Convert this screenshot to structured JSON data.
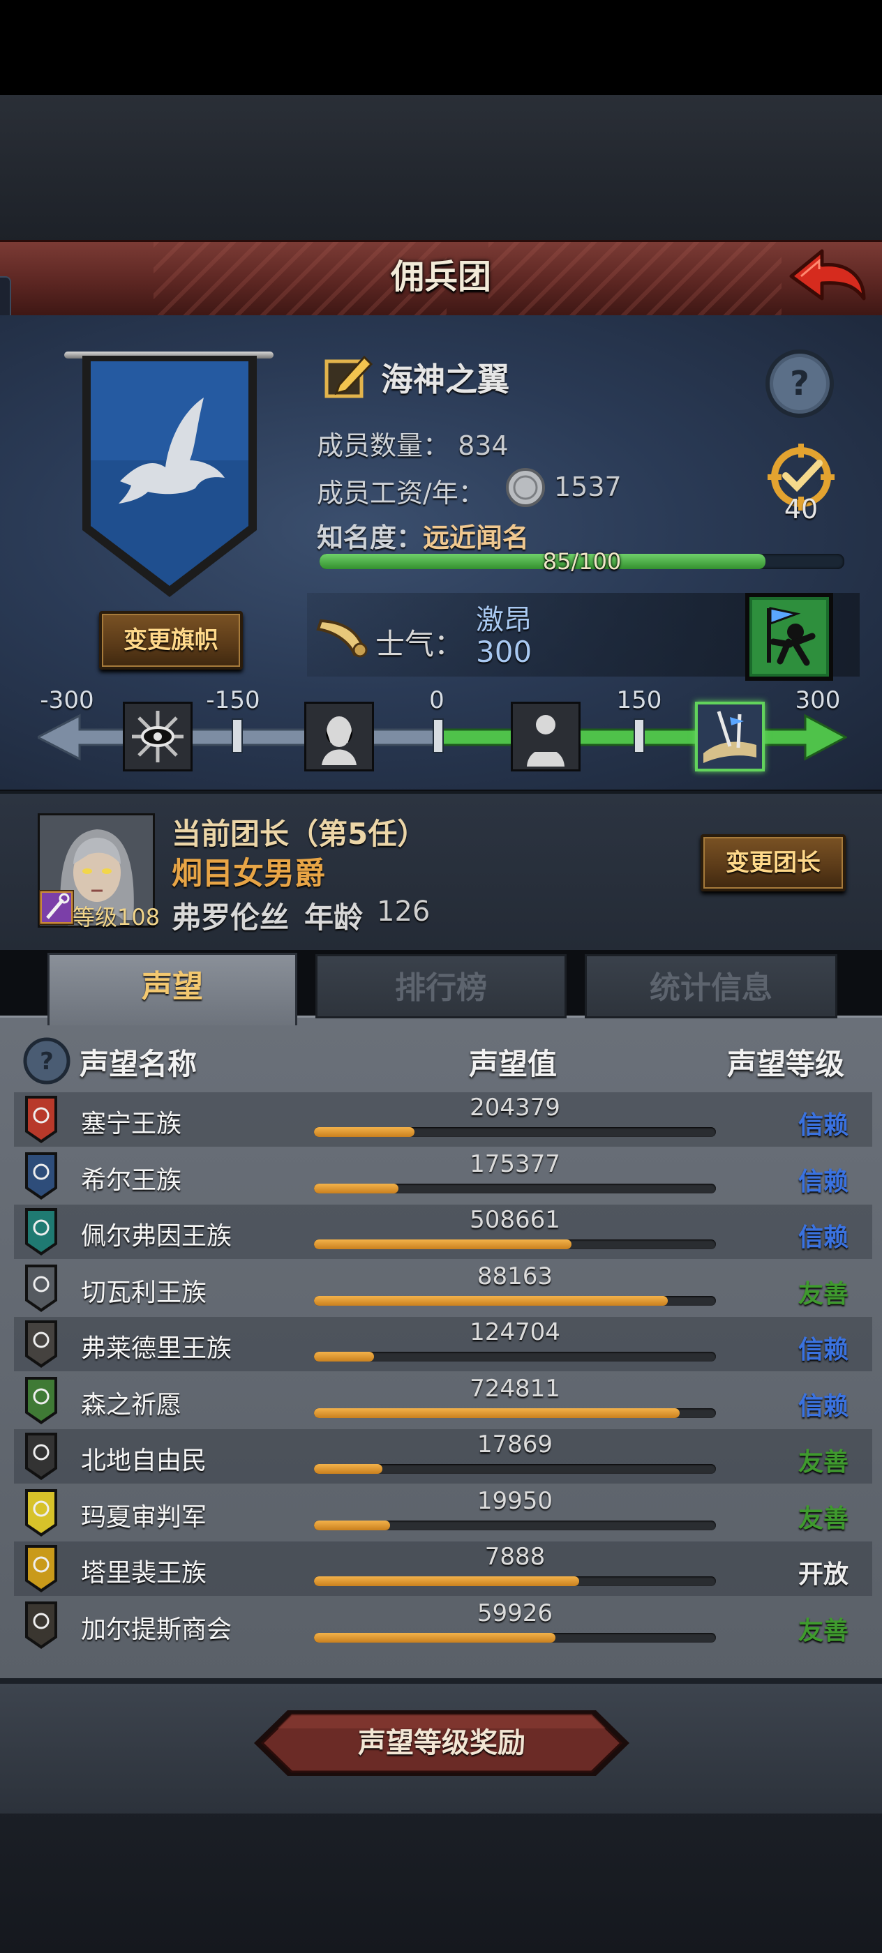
{
  "header": {
    "title": "佣兵团"
  },
  "guild": {
    "name": "海神之翼",
    "change_flag_label": "变更旗帜",
    "members_label": "成员数量：",
    "members_value": "834",
    "wage_label": "成员工资/年：",
    "wage_value": "1537",
    "fame_label": "知名度：",
    "fame_value": "远近闻名",
    "fame_progress_text": "85/100",
    "fame_progress": 0.85,
    "badge_value": "40"
  },
  "morale": {
    "label": "士气：",
    "state": "激昂",
    "value": "300",
    "scale_min": -300,
    "scale_max": 300,
    "current": 300,
    "ticks": [
      "-300",
      "-150",
      "0",
      "150",
      "300"
    ]
  },
  "leader": {
    "title": "当前团长（第5任）",
    "rank": "炯目女男爵",
    "name": "弗罗伦丝",
    "age_label": "年龄",
    "age_value": "126",
    "level_text": "等级108",
    "change_leader_label": "变更团长"
  },
  "tabs": [
    {
      "label": "声望",
      "active": true
    },
    {
      "label": "排行榜",
      "active": false
    },
    {
      "label": "统计信息",
      "active": false
    }
  ],
  "table": {
    "headers": {
      "name": "声望名称",
      "value": "声望值",
      "level": "声望等级"
    },
    "rows": [
      {
        "name": "塞宁王族",
        "value": "204379",
        "progress": 0.25,
        "level": "信赖",
        "level_color": "#3a72e0",
        "icon_color": "#b8392a"
      },
      {
        "name": "希尔王族",
        "value": "175377",
        "progress": 0.21,
        "level": "信赖",
        "level_color": "#3a72e0",
        "icon_color": "#2e4d7a"
      },
      {
        "name": "佩尔弗因王族",
        "value": "508661",
        "progress": 0.64,
        "level": "信赖",
        "level_color": "#3a72e0",
        "icon_color": "#1f7a72"
      },
      {
        "name": "切瓦利王族",
        "value": "88163",
        "progress": 0.88,
        "level": "友善",
        "level_color": "#3f9a2e",
        "icon_color": "#555a60"
      },
      {
        "name": "弗莱德里王族",
        "value": "124704",
        "progress": 0.15,
        "level": "信赖",
        "level_color": "#3a72e0",
        "icon_color": "#45423f"
      },
      {
        "name": "森之祈愿",
        "value": "724811",
        "progress": 0.91,
        "level": "信赖",
        "level_color": "#3a72e0",
        "icon_color": "#3f7a35"
      },
      {
        "name": "北地自由民",
        "value": "17869",
        "progress": 0.17,
        "level": "友善",
        "level_color": "#3f9a2e",
        "icon_color": "#333"
      },
      {
        "name": "玛夏审判军",
        "value": "19950",
        "progress": 0.19,
        "level": "友善",
        "level_color": "#3f9a2e",
        "icon_color": "#d7c22a"
      },
      {
        "name": "塔里裴王族",
        "value": "7888",
        "progress": 0.66,
        "level": "开放",
        "level_color": "#eeeeee",
        "icon_color": "#c99a1a"
      },
      {
        "name": "加尔提斯商会",
        "value": "59926",
        "progress": 0.6,
        "level": "友善",
        "level_color": "#3f9a2e",
        "icon_color": "#3a3630"
      }
    ]
  },
  "footer": {
    "reward_button_label": "声望等级奖励"
  }
}
